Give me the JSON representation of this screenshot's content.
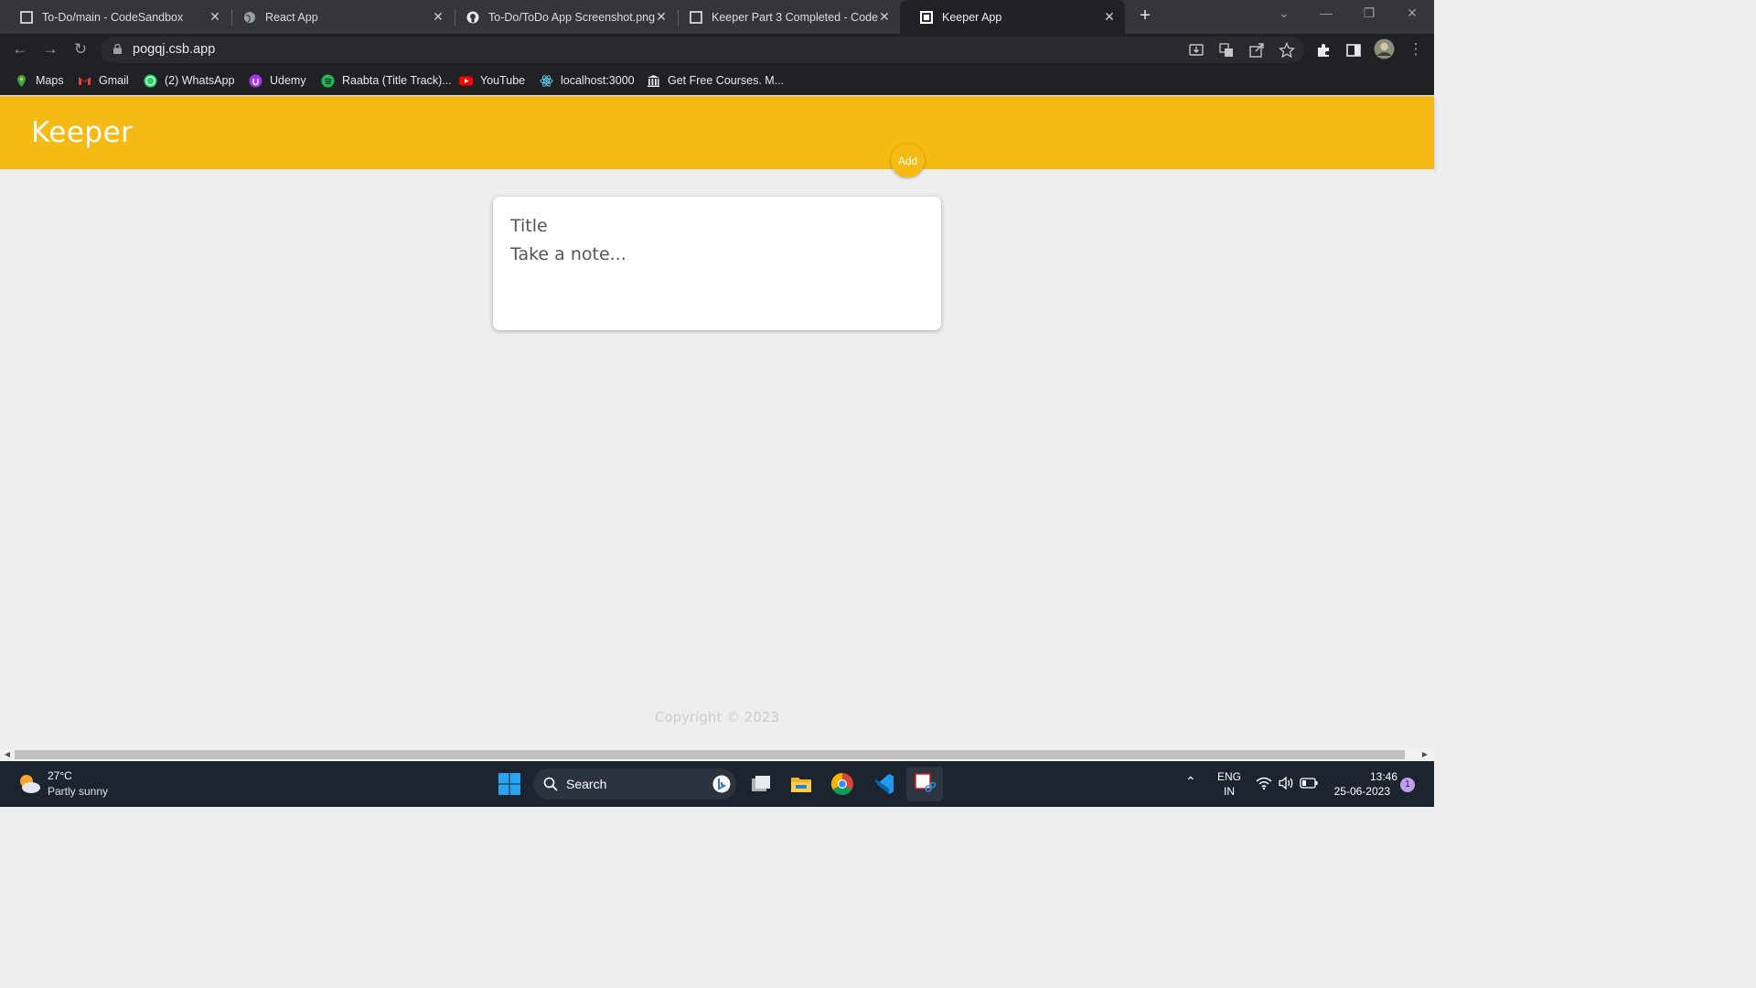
{
  "browser": {
    "tabs": [
      {
        "title": "To-Do/main - CodeSandbox",
        "active": false
      },
      {
        "title": "React App",
        "active": false
      },
      {
        "title": "To-Do/ToDo App Screenshot.png",
        "active": false
      },
      {
        "title": "Keeper Part 3 Completed - CodeS",
        "active": false
      },
      {
        "title": "Keeper App",
        "active": true
      }
    ],
    "url": "pogqj.csb.app",
    "bookmarks": [
      {
        "label": "Maps",
        "icon": "maps-icon",
        "color": "#34a853"
      },
      {
        "label": "Gmail",
        "icon": "gmail-icon",
        "color": "#ea4335"
      },
      {
        "label": "(2) WhatsApp",
        "icon": "whatsapp-icon",
        "color": "#25d366"
      },
      {
        "label": "Udemy",
        "icon": "udemy-icon",
        "color": "#a435f0"
      },
      {
        "label": "Raabta (Title Track)...",
        "icon": "spotify-icon",
        "color": "#1db954"
      },
      {
        "label": "YouTube",
        "icon": "youtube-icon",
        "color": "#ff0000"
      },
      {
        "label": "localhost:3000",
        "icon": "react-icon",
        "color": "#61dafb"
      },
      {
        "label": "Get Free Courses. M...",
        "icon": "courses-icon",
        "color": "#e8eaed"
      }
    ]
  },
  "app": {
    "brand": "Keeper",
    "accent": "#f5ba13",
    "form": {
      "title_placeholder": "Title",
      "content_placeholder": "Take a note...",
      "add_label": "Add"
    },
    "footer": "Copyright © 2023"
  },
  "taskbar": {
    "weather_temp": "27°C",
    "weather_desc": "Partly sunny",
    "search_label": "Search",
    "lang_top": "ENG",
    "lang_bottom": "IN",
    "time": "13:46",
    "date": "25-06-2023",
    "notification_count": "1"
  }
}
